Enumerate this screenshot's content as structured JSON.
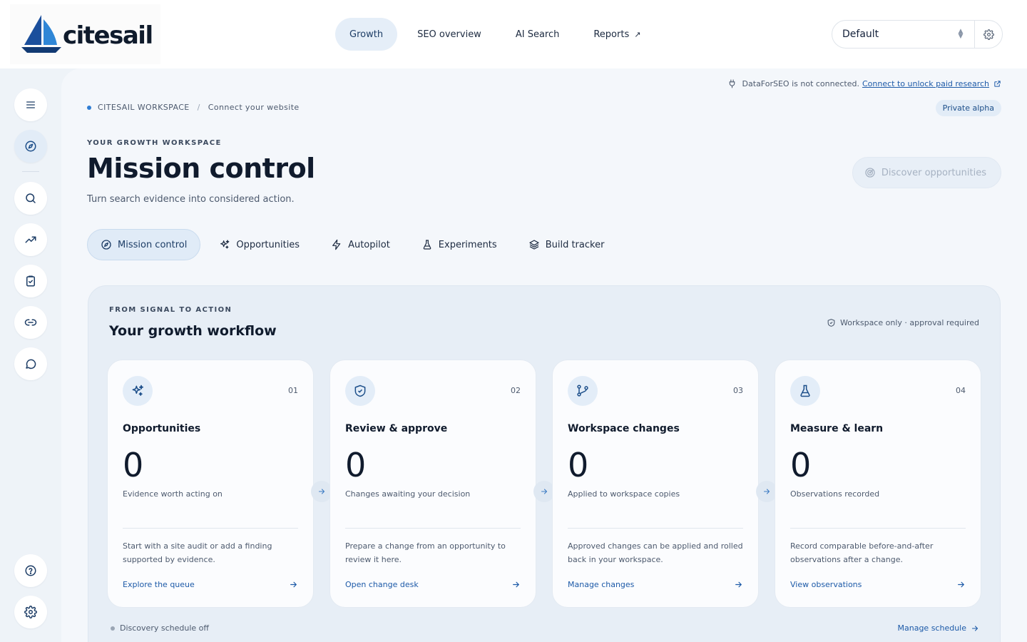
{
  "brand": {
    "name": "citesail"
  },
  "topnav": {
    "items": [
      {
        "label": "Growth",
        "active": true
      },
      {
        "label": "SEO overview"
      },
      {
        "label": "AI Search"
      },
      {
        "label": "Reports",
        "external": true
      }
    ]
  },
  "profile_select": {
    "value": "Default"
  },
  "rail": {
    "items": [
      "menu-icon",
      "compass-icon",
      "search-icon",
      "trending-icon",
      "clipboard-check-icon",
      "link-icon",
      "chat-icon",
      "help-icon",
      "gear-icon"
    ]
  },
  "notice": {
    "text": "DataForSEO is not connected.",
    "link": "Connect to unlock paid research"
  },
  "breadcrumb": {
    "workspace": "CITESAIL WORKSPACE",
    "separator": "/",
    "current": "Connect your website"
  },
  "badge": "Private alpha",
  "header": {
    "eyebrow": "YOUR GROWTH WORKSPACE",
    "title": "Mission control",
    "subtitle": "Turn search evidence into considered action.",
    "discover_label": "Discover opportunities"
  },
  "tabs": [
    {
      "label": "Mission control",
      "icon": "compass-icon",
      "active": true
    },
    {
      "label": "Opportunities",
      "icon": "sparkles-icon"
    },
    {
      "label": "Autopilot",
      "icon": "bolt-icon"
    },
    {
      "label": "Experiments",
      "icon": "flask-icon"
    },
    {
      "label": "Build tracker",
      "icon": "layers-icon"
    }
  ],
  "workflow": {
    "eyebrow": "FROM SIGNAL TO ACTION",
    "title": "Your growth workflow",
    "note": "Workspace only · approval required",
    "cards": [
      {
        "num": "01",
        "icon": "sparkles-icon",
        "title": "Opportunities",
        "count": "0",
        "caption": "Evidence worth acting on",
        "desc": "Start with a site audit or add a finding supported by evidence.",
        "link": "Explore the queue"
      },
      {
        "num": "02",
        "icon": "shield-check-icon",
        "title": "Review & approve",
        "count": "0",
        "caption": "Changes awaiting your decision",
        "desc": "Prepare a change from an opportunity to review it here.",
        "link": "Open change desk"
      },
      {
        "num": "03",
        "icon": "git-branch-icon",
        "title": "Workspace changes",
        "count": "0",
        "caption": "Applied to workspace copies",
        "desc": "Approved changes can be applied and rolled back in your workspace.",
        "link": "Manage changes"
      },
      {
        "num": "04",
        "icon": "flask-icon",
        "title": "Measure & learn",
        "count": "0",
        "caption": "Observations recorded",
        "desc": "Record comparable before-and-after observations after a change.",
        "link": "View observations"
      }
    ],
    "schedule_status": "Discovery schedule off",
    "schedule_link": "Manage schedule"
  },
  "colors": {
    "accent": "#1d5aa8",
    "accent_soft": "#e2ecf7",
    "text": "#101b2d",
    "muted": "#4d5a6e"
  }
}
